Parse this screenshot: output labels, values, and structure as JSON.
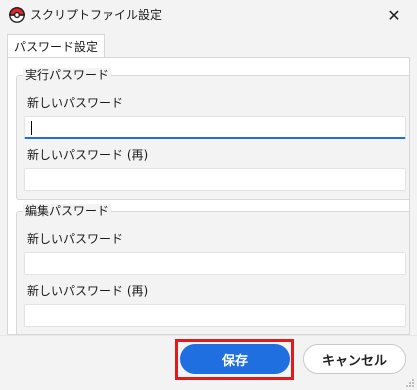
{
  "window": {
    "title": "スクリプトファイル設定",
    "app_icon": "pokeball-icon",
    "close_glyph": "✕"
  },
  "tabs": [
    {
      "label": "パスワード設定",
      "active": true
    }
  ],
  "groups": {
    "run": {
      "legend": "実行パスワード",
      "new_label": "新しいパスワード",
      "confirm_label": "新しいパスワード (再)",
      "new_value": "",
      "confirm_value": ""
    },
    "edit": {
      "legend": "編集パスワード",
      "new_label": "新しいパスワード",
      "confirm_label": "新しいパスワード (再)",
      "new_value": "",
      "confirm_value": ""
    }
  },
  "buttons": {
    "save_label": "保存",
    "cancel_label": "キャンセル"
  },
  "colors": {
    "accent": "#1f6fe0",
    "highlight": "#e11a1a",
    "background": "#f3f3f3"
  }
}
